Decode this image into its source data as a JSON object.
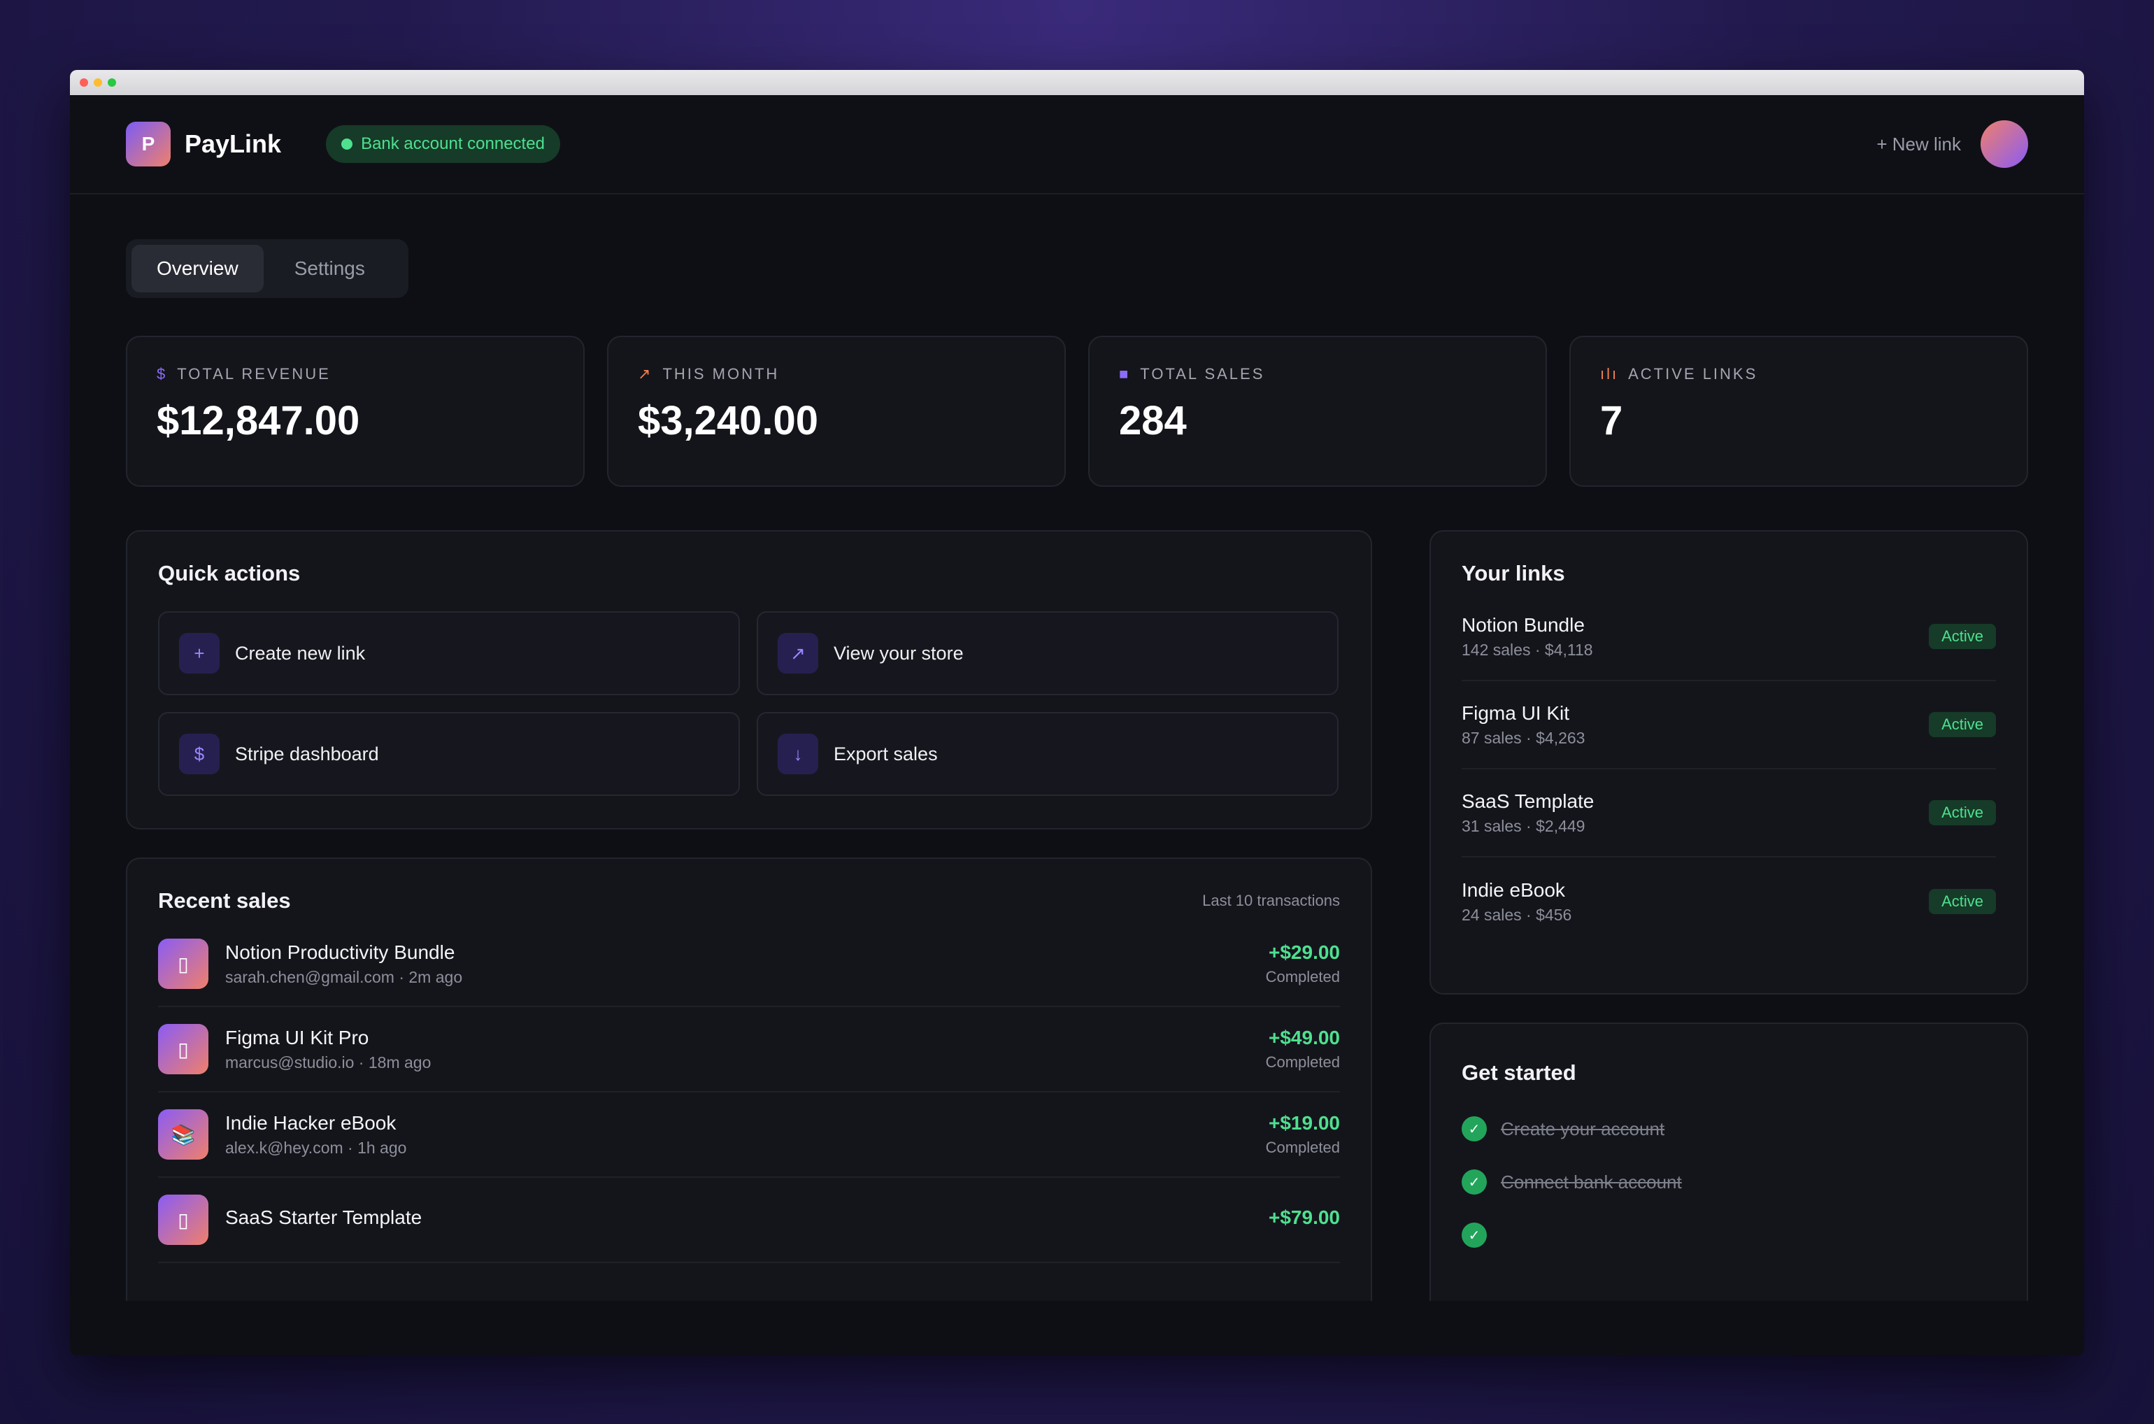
{
  "app": {
    "name": "PayLink",
    "logo_letter": "P"
  },
  "header": {
    "bank_status": "Bank account connected",
    "new_link": "+ New link"
  },
  "tabs": [
    {
      "label": "Overview",
      "active": true
    },
    {
      "label": "Settings",
      "active": false
    }
  ],
  "stats": [
    {
      "icon": "dollar-icon",
      "glyph": "$",
      "color": "#8b6cf6",
      "label": "TOTAL REVENUE",
      "value": "$12,847.00"
    },
    {
      "icon": "trend-up-icon",
      "glyph": "↗",
      "color": "#f08050",
      "label": "THIS MONTH",
      "value": "$3,240.00"
    },
    {
      "icon": "shopping-bag-icon",
      "glyph": "■",
      "color": "#8b6cf6",
      "label": "TOTAL SALES",
      "value": "284"
    },
    {
      "icon": "bar-chart-icon",
      "glyph": "ılı",
      "color": "#f08050",
      "label": "ACTIVE LINKS",
      "value": "7"
    }
  ],
  "quick_actions": {
    "title": "Quick actions",
    "items": [
      {
        "icon": "plus-icon",
        "glyph": "+",
        "label": "Create new link"
      },
      {
        "icon": "arrow-up-right-icon",
        "glyph": "↗",
        "label": "View your store"
      },
      {
        "icon": "dollar-icon",
        "glyph": "$",
        "label": "Stripe dashboard"
      },
      {
        "icon": "arrow-down-icon",
        "glyph": "↓",
        "label": "Export sales"
      }
    ]
  },
  "recent_sales": {
    "title": "Recent sales",
    "subtitle": "Last 10 transactions",
    "items": [
      {
        "icon": "product-icon",
        "glyph": "▯",
        "name": "Notion Productivity Bundle",
        "meta": "sarah.chen@gmail.com · 2m ago",
        "amount": "+$29.00",
        "status": "Completed"
      },
      {
        "icon": "product-icon",
        "glyph": "▯",
        "name": "Figma UI Kit Pro",
        "meta": "marcus@studio.io · 18m ago",
        "amount": "+$49.00",
        "status": "Completed"
      },
      {
        "icon": "book-icon",
        "glyph": "📚",
        "name": "Indie Hacker eBook",
        "meta": "alex.k@hey.com · 1h ago",
        "amount": "+$19.00",
        "status": "Completed"
      },
      {
        "icon": "product-icon",
        "glyph": "▯",
        "name": "SaaS Starter Template",
        "meta": "",
        "amount": "+$79.00",
        "status": ""
      }
    ]
  },
  "your_links": {
    "title": "Your links",
    "items": [
      {
        "name": "Notion Bundle",
        "meta": "142 sales · $4,118",
        "status": "Active"
      },
      {
        "name": "Figma UI Kit",
        "meta": "87 sales · $4,263",
        "status": "Active"
      },
      {
        "name": "SaaS Template",
        "meta": "31 sales · $2,449",
        "status": "Active"
      },
      {
        "name": "Indie eBook",
        "meta": "24 sales · $456",
        "status": "Active"
      }
    ]
  },
  "get_started": {
    "title": "Get started",
    "items": [
      {
        "label": "Create your account",
        "done": true
      },
      {
        "label": "Connect bank account",
        "done": true
      },
      {
        "label": "",
        "done": true
      }
    ]
  },
  "colors": {
    "accent": "#8b6cf6",
    "success": "#4ee08f",
    "background": "#0e0f14",
    "card": "#14151b"
  }
}
